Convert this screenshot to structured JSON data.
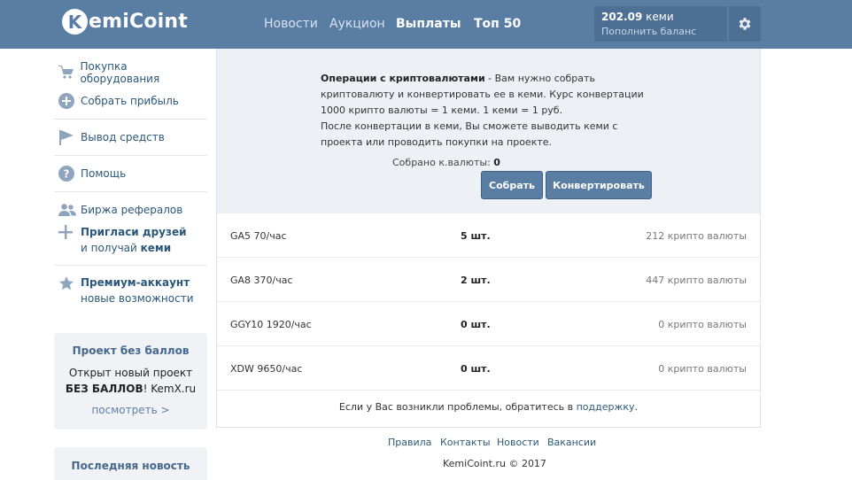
{
  "header": {
    "logo_letter": "K",
    "logo_rest": "emiCoint",
    "nav": [
      "Новости",
      "Аукцион",
      "Выплаты",
      "Топ 50"
    ],
    "balance_amount": "202.09",
    "balance_unit": "кеми",
    "balance_link": "Пополнить баланс",
    "settings_icon": "gear-icon"
  },
  "sidebar": {
    "items": [
      {
        "label": "Покупка оборудования",
        "icon": "cart-icon"
      },
      {
        "label": "Собрать прибыль",
        "icon": "plus-circle-icon"
      },
      {
        "label": "Вывод средств",
        "icon": "flag-icon"
      },
      {
        "label": "Помощь",
        "icon": "question-icon"
      },
      {
        "label": "Биржа рефералов",
        "icon": "users-icon"
      }
    ],
    "invite_bold": "Пригласи друзей",
    "invite_line2_pre": "и получай ",
    "invite_line2_bold": "кеми",
    "premium_bold": "Премиум-аккаунт",
    "premium_line2": "новые возможности"
  },
  "promo": {
    "title": "Проект без баллов",
    "line1": "Открыт новый проект",
    "line2_bold": "БЕЗ БАЛЛОВ",
    "line2_rest": "! KemX.ru",
    "link": "посмотреть >"
  },
  "news": {
    "title": "Последняя новость"
  },
  "main": {
    "info_bold": "Операции с криптовалютами",
    "info_line1": " - Вам нужно собрать криптовалюту и конвертировать ее в кеми. Курс конвертации 1000 крипто валюты = 1 кеми. 1 кеми = 1 руб.",
    "info_line2": "После конвертации в кеми, Вы сможете выводить кеми с проекта или проводить покупки на проекте.",
    "collected_label": "Собрано к.валюты:",
    "collected_value": "0",
    "collect_button": "Собрать",
    "convert_button": "Конвертировать",
    "rows": [
      {
        "name": "GA5 70/час",
        "count": "5 шт.",
        "amount": "212 крипто валюты"
      },
      {
        "name": "GA8 370/час",
        "count": "2 шт.",
        "amount": "447 крипто валюты"
      },
      {
        "name": "GGY10 1920/час",
        "count": "0 шт.",
        "amount": "0 крипто валюты"
      },
      {
        "name": "XDW 9650/час",
        "count": "0 шт.",
        "amount": "0 крипто валюты"
      }
    ],
    "help_text": "Если у Вас возникли проблемы, обратитесь в ",
    "help_link": "поддержку",
    "help_end": "."
  },
  "footer": {
    "links": [
      "Правила",
      "Контакты",
      "Новости",
      "Вакансии"
    ],
    "copyright": "KemiCoint.ru © 2017"
  },
  "colors": {
    "header": "#597da3",
    "accent": "#2b587a",
    "panel": "#edf0f4"
  }
}
